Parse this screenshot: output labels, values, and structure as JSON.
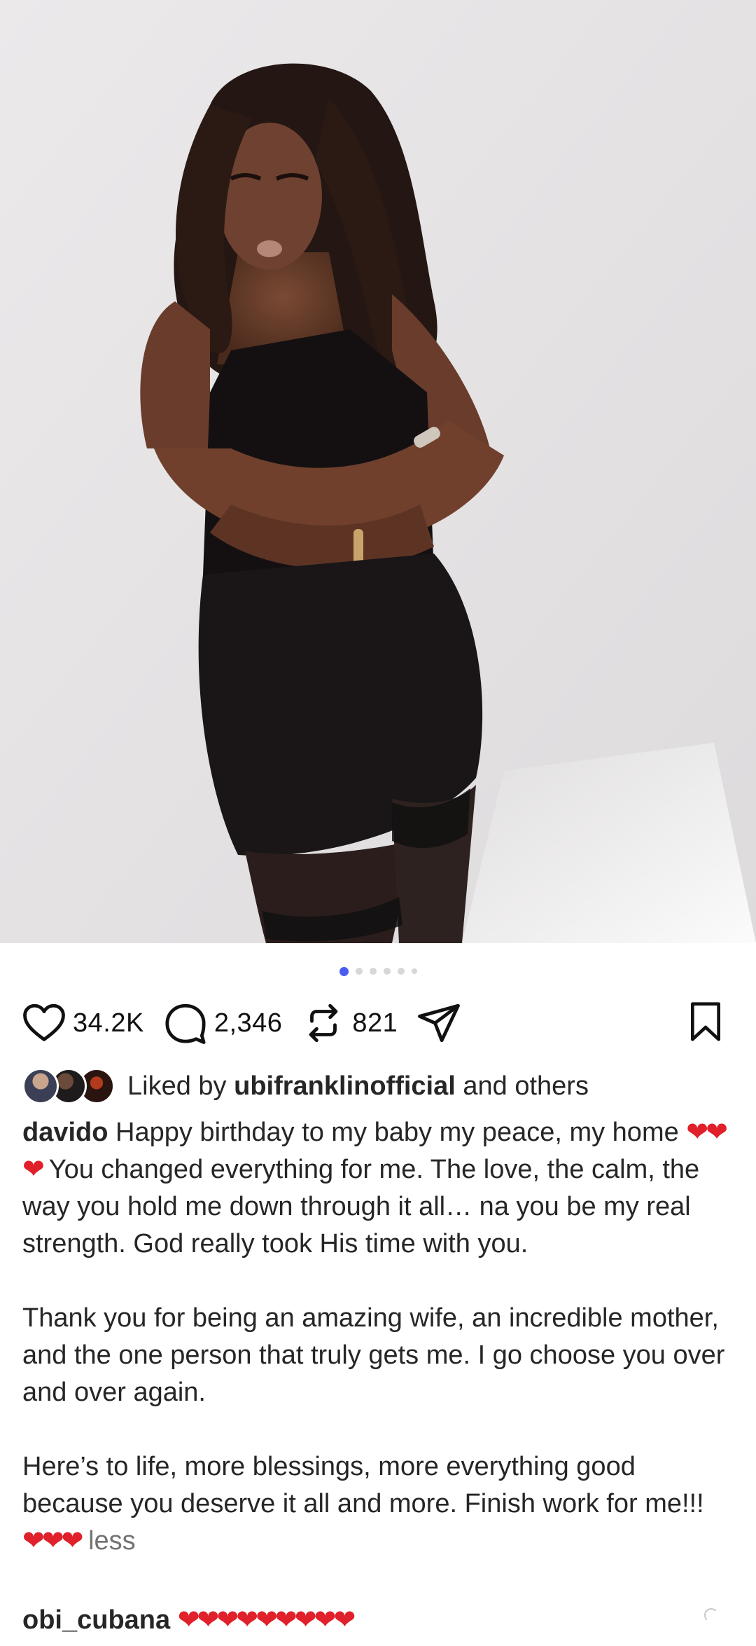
{
  "post": {
    "image_alt": "Photo of a woman in a black dress",
    "carousel": {
      "total": 6,
      "active_index": 0
    }
  },
  "actions": {
    "likes": "34.2K",
    "comments": "2,346",
    "reposts": "821"
  },
  "liked_by": {
    "prefix": "Liked by",
    "user": "ubifranklinofficial",
    "suffix": "and others"
  },
  "caption": {
    "username": "davido",
    "p1_a": "Happy birthday to my baby my peace, my home",
    "p1_hearts": "❤❤❤",
    "p1_b": "You changed everything for me. The love, the calm, the way you hold me down through it all… na you be my real strength. God really took His time with you.",
    "p2": "Thank you for being an amazing wife, an incredible mother, and the one person that truly gets me. I go choose you over and over again.",
    "p3": "Here’s to life, more blessings, more everything good because you deserve it all and more. Finish work for me!!!",
    "p3_hearts": "❤❤❤",
    "less": "less"
  },
  "comment": {
    "username": "obi_cubana",
    "text": "❤❤❤❤❤❤❤❤❤"
  },
  "colors": {
    "accent_dot": "#4b5cf0",
    "heart_red": "#e0202a",
    "text": "#262626",
    "muted": "#737373"
  }
}
